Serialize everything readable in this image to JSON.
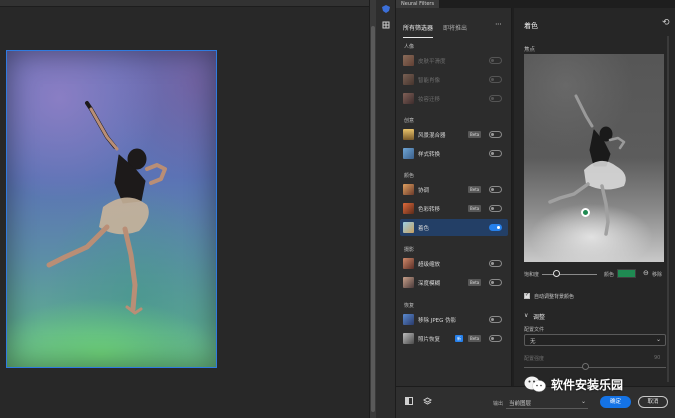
{
  "panel": {
    "title": "Neural Filters"
  },
  "tabs": {
    "all_filters": "所有筛选器",
    "waitlist": "即将推出"
  },
  "categories": {
    "portrait": "人像",
    "creative": "创意",
    "color": "颜色",
    "photography": "摄影",
    "restoration": "恢复"
  },
  "filters": [
    {
      "label": "皮肤平滑度",
      "state": "disabled"
    },
    {
      "label": "智能肖像",
      "state": "disabled"
    },
    {
      "label": "妆容迁移",
      "state": "disabled"
    },
    {
      "label": "风景混合器",
      "badge": "Beta",
      "state": "off"
    },
    {
      "label": "样式转换",
      "state": "off"
    },
    {
      "label": "协调",
      "badge": "Beta",
      "state": "off"
    },
    {
      "label": "色彩转移",
      "badge": "Beta",
      "state": "off"
    },
    {
      "label": "着色",
      "state": "on",
      "selected": true
    },
    {
      "label": "超级缩放",
      "state": "off"
    },
    {
      "label": "深度模糊",
      "badge": "Beta",
      "state": "off"
    },
    {
      "label": "移除 JPEG 伪影",
      "state": "off"
    },
    {
      "label": "照片恢复",
      "badge_new": "新",
      "badge": "Beta",
      "state": "off"
    }
  ],
  "settings": {
    "title": "着色",
    "focus_label": "焦点",
    "saturation_label": "饱和度",
    "color_label": "颜色",
    "delete_label": "移除",
    "auto_color_label": "自动调整背景颜色",
    "adjustments_title": "调整",
    "profile_label": "配置文件",
    "profile_value": "无",
    "strength_label": "配置强度",
    "strength_value": "90"
  },
  "colors": {
    "selected_color": "#1f8a52",
    "accent": "#1473e6"
  },
  "bottom": {
    "output_label": "输出",
    "output_value": "当前图层",
    "ok": "确定",
    "cancel": "取消"
  },
  "watermark": {
    "text": "软件安装乐园"
  }
}
